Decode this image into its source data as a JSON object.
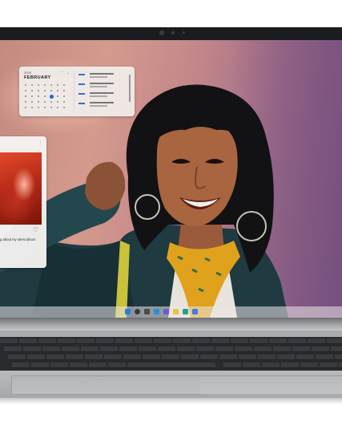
{
  "calendar_widget": {
    "year": "2023",
    "month": "FEBRUARY",
    "nav_up": "⌃",
    "nav_down": "⌄"
  },
  "music_widget": {
    "caption": "g about my latest album",
    "menu_glyph": "⋮",
    "heart_glyph": "♡"
  },
  "colors": {
    "accent_blue": "#1a67c9",
    "screen_pink": "#c48a80",
    "jacket": "#1f3a40",
    "scarf_yellow": "#e0a21c",
    "bag_strap": "#c9c23a"
  }
}
